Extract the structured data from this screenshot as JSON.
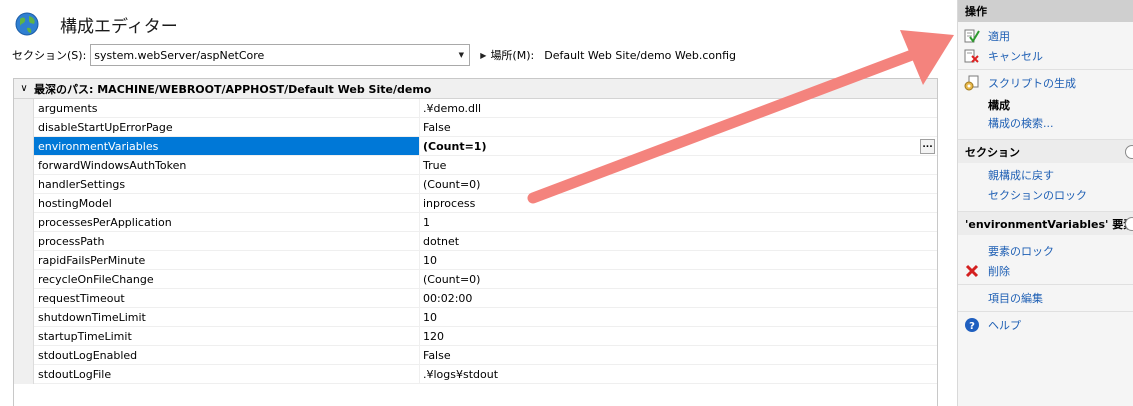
{
  "title": "構成エディター",
  "section": {
    "label": "セクション(S):",
    "value": "system.webServer/aspNetCore"
  },
  "location": {
    "label": "場所(M):",
    "value": "Default Web Site/demo Web.config"
  },
  "grid": {
    "header": "最深のパス: MACHINE/WEBROOT/APPHOST/Default Web Site/demo",
    "rows": [
      {
        "name": "arguments",
        "value": ".¥demo.dll"
      },
      {
        "name": "disableStartUpErrorPage",
        "value": "False"
      },
      {
        "name": "environmentVariables",
        "value": "(Count=1)"
      },
      {
        "name": "forwardWindowsAuthToken",
        "value": "True"
      },
      {
        "name": "handlerSettings",
        "value": "(Count=0)"
      },
      {
        "name": "hostingModel",
        "value": "inprocess"
      },
      {
        "name": "processesPerApplication",
        "value": "1"
      },
      {
        "name": "processPath",
        "value": "dotnet"
      },
      {
        "name": "rapidFailsPerMinute",
        "value": "10"
      },
      {
        "name": "recycleOnFileChange",
        "value": "(Count=0)"
      },
      {
        "name": "requestTimeout",
        "value": "00:02:00"
      },
      {
        "name": "shutdownTimeLimit",
        "value": "10"
      },
      {
        "name": "startupTimeLimit",
        "value": "120"
      },
      {
        "name": "stdoutLogEnabled",
        "value": "False"
      },
      {
        "name": "stdoutLogFile",
        "value": ".¥logs¥stdout"
      }
    ],
    "ellipsis": "..."
  },
  "actions": {
    "header": "操作",
    "apply": "適用",
    "cancel": "キャンセル",
    "generate_script": "スクリプトの生成",
    "config_heading": "構成",
    "search_config": "構成の検索...",
    "section_group": "セクション",
    "revert_to_parent": "親構成に戻す",
    "lock_section": "セクションのロック",
    "element_group": "'environmentVariables' 要素",
    "lock_element": "要素のロック",
    "delete": "削除",
    "edit_items": "項目の編集",
    "help": "ヘルプ"
  },
  "colors": {
    "selection": "#0078d7",
    "link": "#1e5fb4",
    "annotation_arrow": "#f4837d"
  }
}
